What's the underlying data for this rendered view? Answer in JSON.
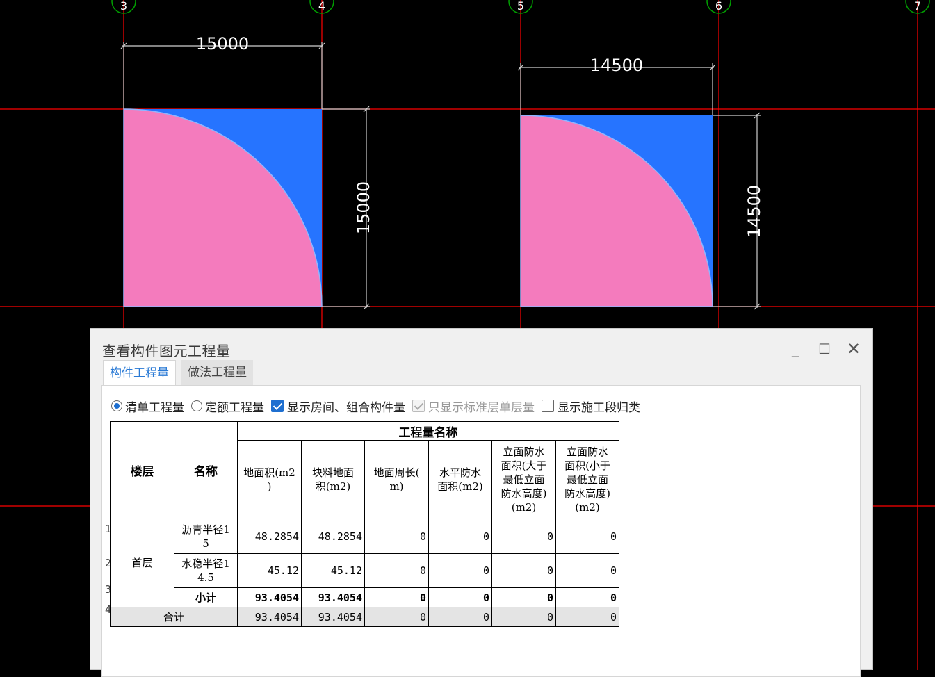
{
  "cad": {
    "axis_labels": [
      "3",
      "4",
      "5",
      "6",
      "7"
    ],
    "dimensions": {
      "left_width": "15000",
      "left_height": "15000",
      "right_width": "14500",
      "right_height": "14500"
    },
    "colors": {
      "grid": "#ff0000",
      "pink_fill": "#f47bbd",
      "blue_fill": "#2674ff",
      "axis_bubble": "#00a000",
      "dimension": "#ffffff"
    }
  },
  "dialog": {
    "title": "查看构件图元工程量",
    "tabs": [
      "构件工程量",
      "做法工程量"
    ],
    "options": {
      "qd_label": "清单工程量",
      "de_label": "定额工程量",
      "show_room_label": "显示房间、组合构件量",
      "std_floor_label": "只显示标准层单层量",
      "stage_label": "显示施工段归类"
    },
    "table": {
      "group_header": "工程量名称",
      "col_floor": "楼层",
      "col_name": "名称",
      "qty_cols": [
        "地面积(m2\n)",
        "块料地面\n积(m2)",
        "地面周长(\nm)",
        "水平防水\n面积(m2)",
        "立面防水\n面积(大于\n最低立面\n防水高度)\n(m2)",
        "立面防水\n面积(小于\n最低立面\n防水高度)\n(m2)"
      ],
      "row_numbers": [
        "1",
        "2",
        "3",
        "4"
      ],
      "floor": "首层",
      "rows": [
        {
          "name": "沥青半径1\n5",
          "values": [
            "48.2854",
            "48.2854",
            "0",
            "0",
            "0",
            "0"
          ]
        },
        {
          "name": "水稳半径1\n4.5",
          "values": [
            "45.12",
            "45.12",
            "0",
            "0",
            "0",
            "0"
          ]
        },
        {
          "name": "小计",
          "values": [
            "93.4054",
            "93.4054",
            "0",
            "0",
            "0",
            "0"
          ]
        }
      ],
      "total": {
        "label": "合计",
        "values": [
          "93.4054",
          "93.4054",
          "0",
          "0",
          "0",
          "0"
        ]
      }
    }
  }
}
